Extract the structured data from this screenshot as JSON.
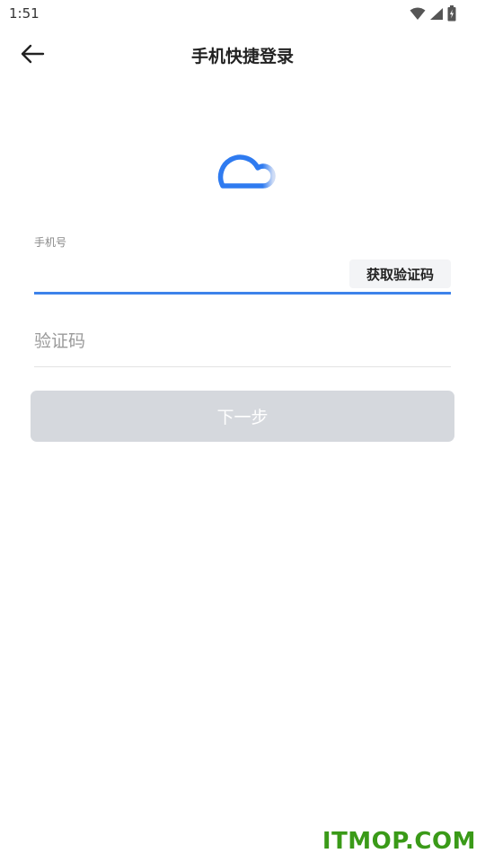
{
  "status_bar": {
    "time": "1:51"
  },
  "header": {
    "title": "手机快捷登录",
    "back_icon": "arrow-left-icon"
  },
  "logo": {
    "icon": "cloud-logo-icon",
    "color": "#2f7bf0"
  },
  "phone_field": {
    "label": "手机号",
    "value": "",
    "get_code_label": "获取验证码",
    "accent_color": "#3d82ea"
  },
  "code_field": {
    "placeholder": "验证码",
    "value": ""
  },
  "next_button": {
    "label": "下一步",
    "disabled_color": "#d5d8dd"
  },
  "watermark": {
    "text": "ITMOP.COM"
  }
}
